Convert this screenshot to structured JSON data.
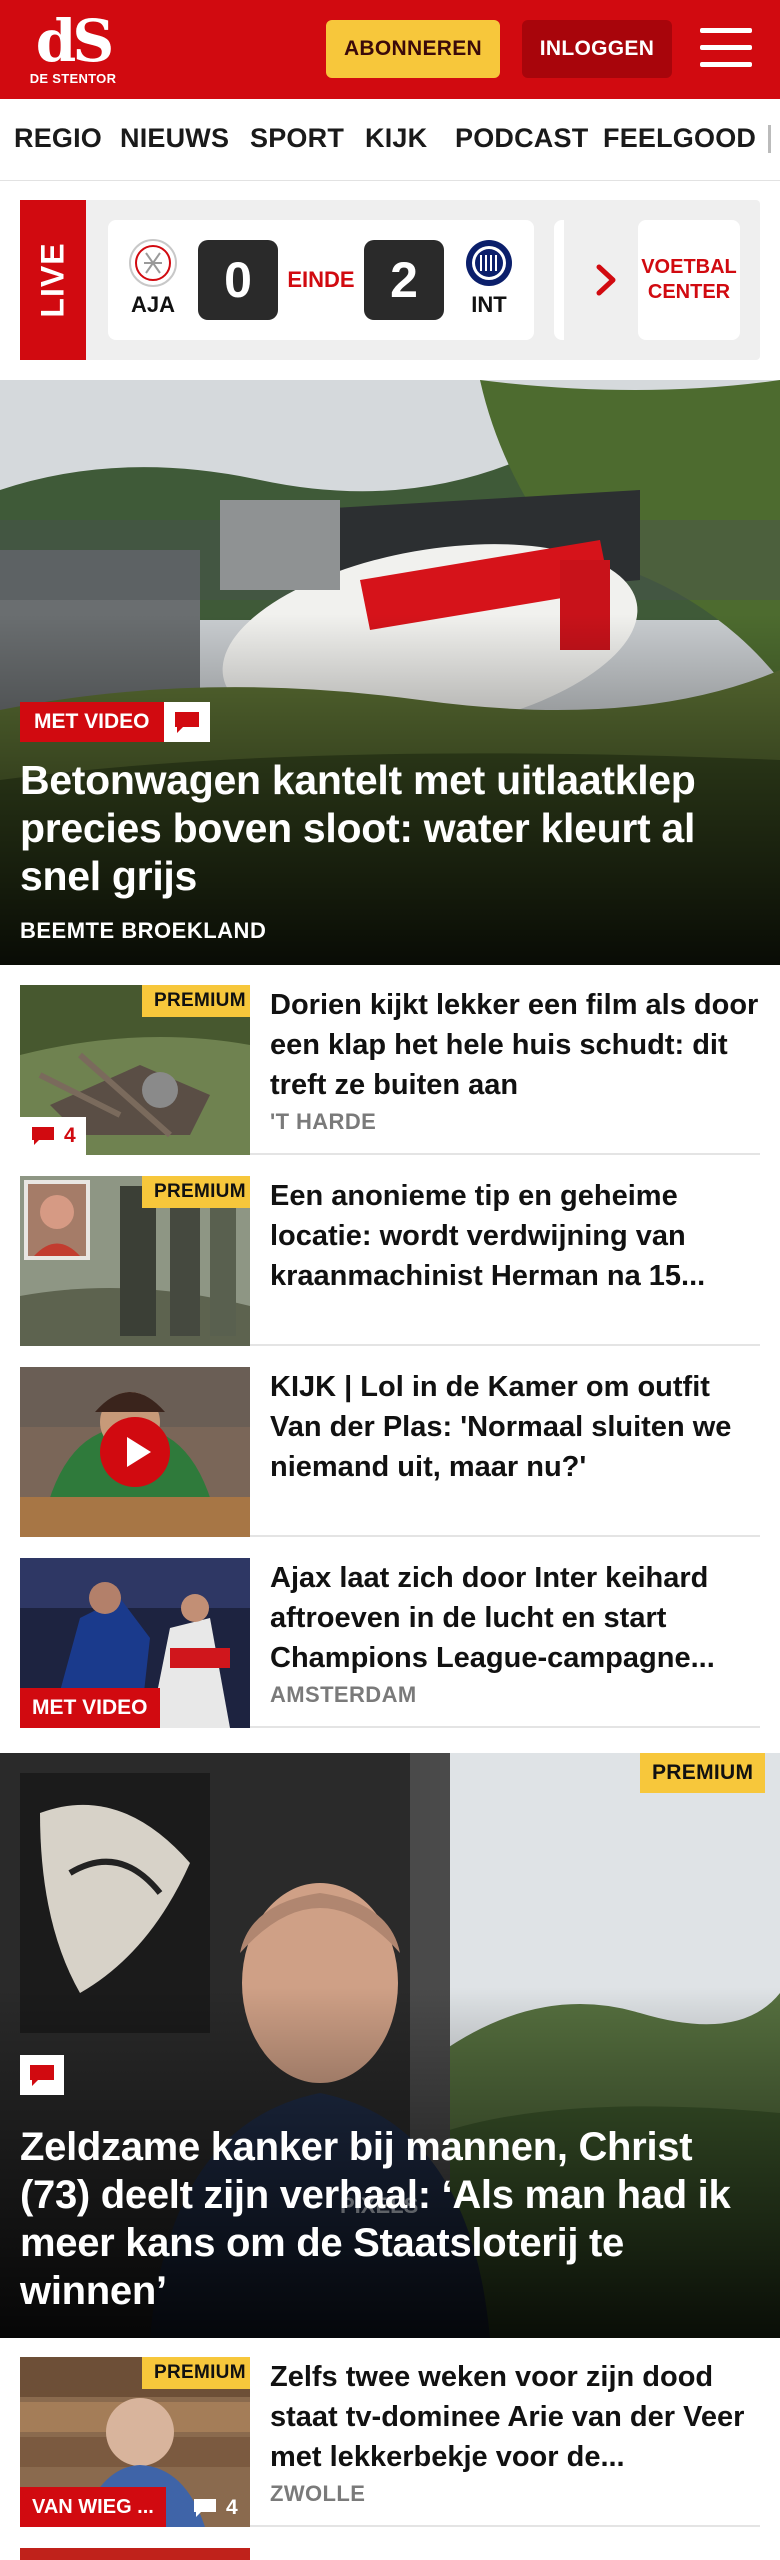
{
  "header": {
    "logo_mark": "dS",
    "logo_sub": "DE STENTOR",
    "subscribe_label": "ABONNEREN",
    "login_label": "INLOGGEN"
  },
  "nav": {
    "items": [
      "REGIO",
      "NIEUWS",
      "SPORT",
      "KIJK",
      "PODCAST",
      "FEELGOOD"
    ]
  },
  "live": {
    "label": "LIVE",
    "home_code": "AJA",
    "away_code": "INT",
    "home_score": "0",
    "away_score": "2",
    "status": "EINDE",
    "voetbal_center_label": "VOETBAL CENTER"
  },
  "hero": {
    "video_label": "MET VIDEO",
    "title": "Betonwagen kantelt met uitlaatklep precies boven sloot: water kleurt al snel grijs",
    "location": "BEEMTE BROEKLAND"
  },
  "articles": [
    {
      "title": "Dorien kijkt lekker een film als door een klap het hele huis schudt: dit treft ze buiten aan",
      "location": "'T HARDE",
      "premium": "PREMIUM",
      "comments": "4"
    },
    {
      "title": "Een anonieme tip en geheime locatie: wordt verdwijning van kraanmachinist Herman na 15...",
      "premium": "PREMIUM"
    },
    {
      "title": "KIJK | Lol in de Kamer om outfit Van der Plas: 'Normaal sluiten we niemand uit, maar nu?'"
    },
    {
      "title": "Ajax laat zich door Inter keihard aftroeven in de lucht en start Champions League-campagne...",
      "location": "AMSTERDAM",
      "video_label": "MET VIDEO"
    }
  ],
  "hero2": {
    "premium": "PREMIUM",
    "title": "Zeldzame kanker bij mannen, Christ (73) deelt zijn verhaal: ‘Als man had ik meer kans om de Staatsloterij te winnen’"
  },
  "article5": {
    "title": "Zelfs twee weken voor zijn dood staat tv-dominee Arie van der Veer met lekkerbekje voor de...",
    "location": "ZWOLLE",
    "premium": "PREMIUM",
    "tag": "VAN WIEG ...",
    "comments": "4"
  },
  "colors": {
    "brand_red": "#d10a10",
    "premium_yellow": "#f7c73b"
  }
}
